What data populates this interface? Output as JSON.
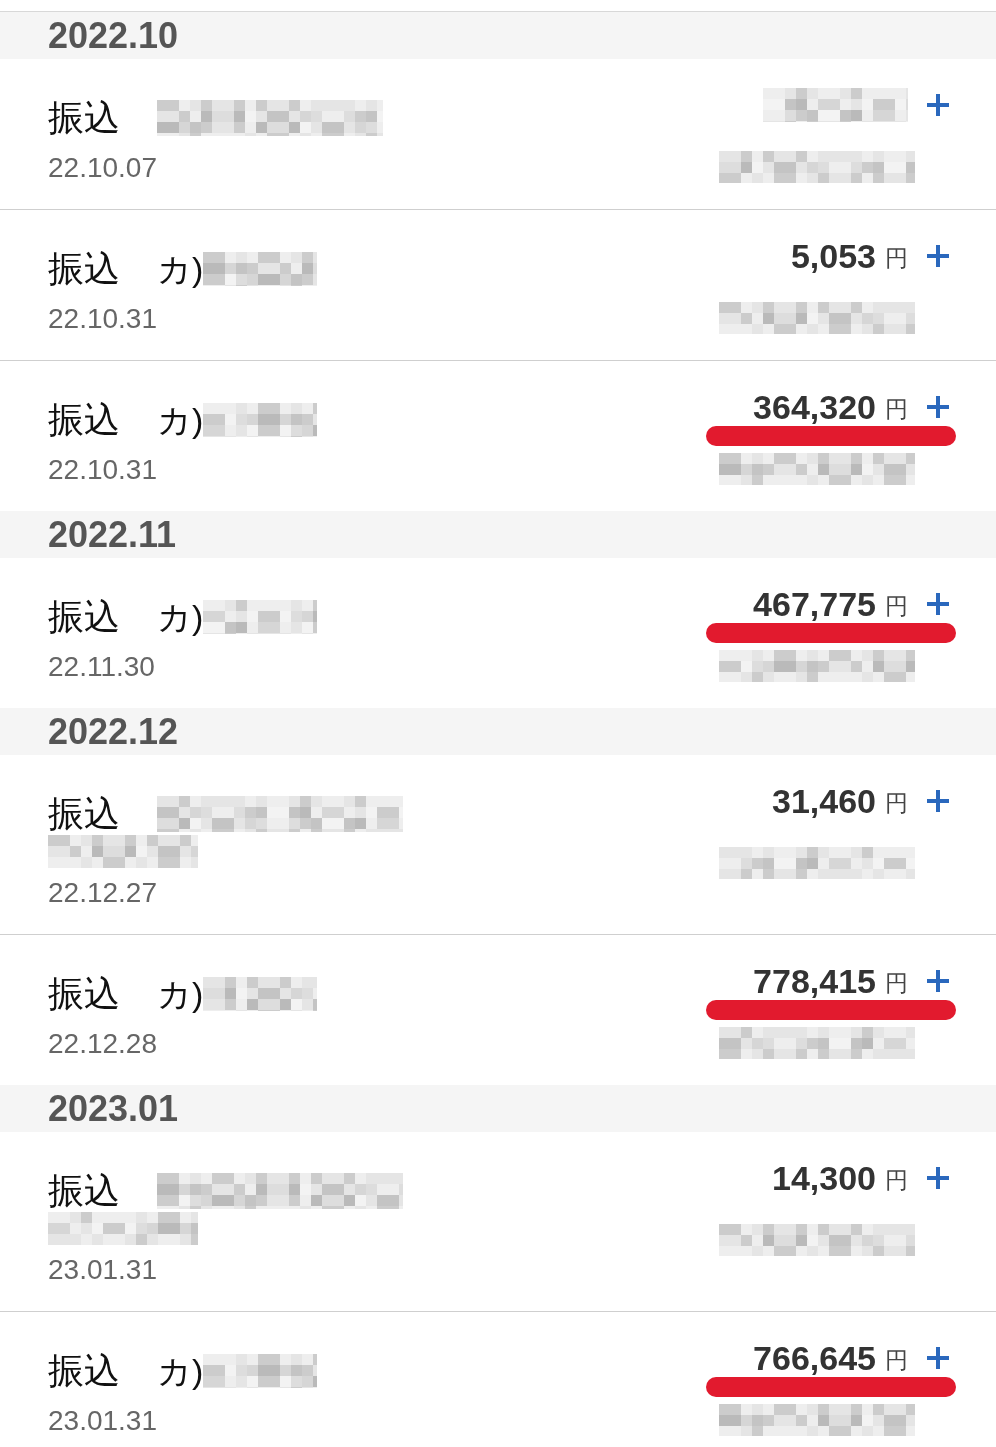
{
  "months": [
    {
      "label": "2022.10",
      "transactions": [
        {
          "label": "振込",
          "kind": "wide",
          "date": "22.10.07",
          "underlined": false
        },
        {
          "label": "振込",
          "kind": "short",
          "prefix": "カ)",
          "date": "22.10.31",
          "amount": "5,053",
          "currency": "円",
          "underlined": false
        },
        {
          "label": "振込",
          "kind": "short",
          "prefix": "カ)",
          "date": "22.10.31",
          "amount": "364,320",
          "currency": "円",
          "underlined": true
        }
      ]
    },
    {
      "label": "2022.11",
      "transactions": [
        {
          "label": "振込",
          "kind": "short",
          "prefix": "カ)",
          "date": "22.11.30",
          "amount": "467,775",
          "currency": "円",
          "underlined": true
        }
      ]
    },
    {
      "label": "2022.12",
      "transactions": [
        {
          "label": "振込",
          "kind": "wrapped",
          "date": "22.12.27",
          "amount": "31,460",
          "currency": "円",
          "underlined": false
        },
        {
          "label": "振込",
          "kind": "short",
          "prefix": "カ)",
          "date": "22.12.28",
          "amount": "778,415",
          "currency": "円",
          "underlined": true
        }
      ]
    },
    {
      "label": "2023.01",
      "transactions": [
        {
          "label": "振込",
          "kind": "wrapped",
          "date": "23.01.31",
          "amount": "14,300",
          "currency": "円",
          "underlined": false
        },
        {
          "label": "振込",
          "kind": "short",
          "prefix": "カ)",
          "date": "23.01.31",
          "amount": "766,645",
          "currency": "円",
          "underlined": true
        }
      ]
    }
  ]
}
